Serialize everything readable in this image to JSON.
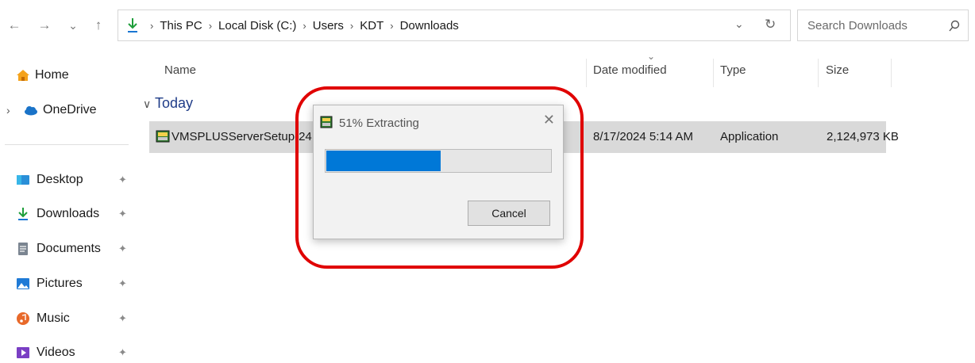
{
  "nav": {
    "back_icon": "←",
    "forward_icon": "→",
    "recent_icon": "⌄",
    "up_icon": "↑",
    "breadcrumbs": [
      "This PC",
      "Local Disk (C:)",
      "Users",
      "KDT",
      "Downloads"
    ],
    "separator": "›",
    "dropdown_icon": "⌄",
    "refresh_icon": "↻",
    "search_placeholder": "Search Downloads",
    "search_icon": "⌕"
  },
  "sidebar": {
    "items": [
      {
        "label": "Home",
        "icon": "home-icon"
      },
      {
        "label": "OneDrive",
        "icon": "cloud-icon",
        "expander": "›"
      },
      {
        "label": "Desktop",
        "icon": "desktop-icon",
        "pinned": true
      },
      {
        "label": "Downloads",
        "icon": "download-icon",
        "pinned": true
      },
      {
        "label": "Documents",
        "icon": "document-icon",
        "pinned": true
      },
      {
        "label": "Pictures",
        "icon": "picture-icon",
        "pinned": true
      },
      {
        "label": "Music",
        "icon": "music-icon",
        "pinned": true
      },
      {
        "label": "Videos",
        "icon": "video-icon",
        "pinned": true
      }
    ],
    "pin_glyph": "📌"
  },
  "columns": {
    "name": "Name",
    "date": "Date modified",
    "type": "Type",
    "size": "Size",
    "sort_icon": "⌄"
  },
  "group": {
    "label": "Today",
    "chevron": "∨"
  },
  "files": [
    {
      "name": "VMSPLUSServerSetup-24.07.5-",
      "date": "8/17/2024 5:14 AM",
      "type": "Application",
      "size": "2,124,973 KB"
    }
  ],
  "dialog": {
    "title": "51% Extracting",
    "close": "✕",
    "progress": 0.51,
    "cancel_label": "Cancel"
  },
  "colors": {
    "accent": "#0078d7",
    "highlight": "#e00000",
    "row_selected": "#d9d9d9"
  }
}
